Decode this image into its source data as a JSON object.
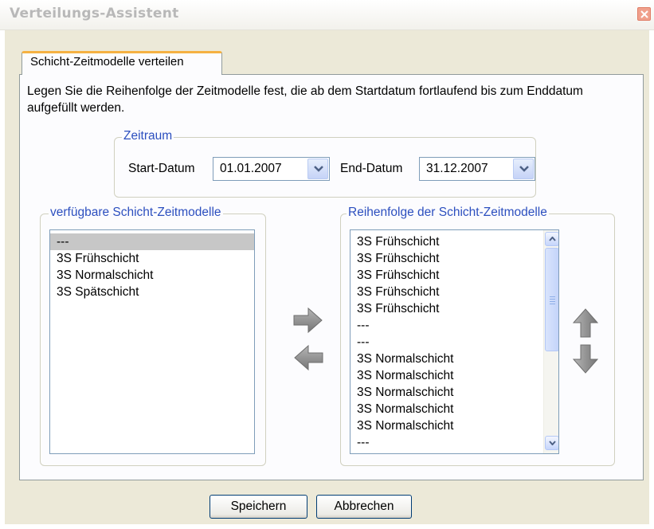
{
  "window": {
    "title": "Verteilungs-Assistent",
    "close_icon": "close-icon"
  },
  "tab": {
    "label": "Schicht-Zeitmodelle verteilen"
  },
  "instruction": "Legen Sie die Reihenfolge der Zeitmodelle fest, die ab dem Startdatum fortlaufend bis zum Enddatum aufgefüllt werden.",
  "zeitraum": {
    "legend": "Zeitraum",
    "start_label": "Start-Datum",
    "start_value": "01.01.2007",
    "end_label": "End-Datum",
    "end_value": "31.12.2007"
  },
  "available": {
    "legend": "verfügbare Schicht-Zeitmodelle",
    "items": [
      "---",
      "3S Frühschicht",
      "3S Normalschicht",
      "3S Spätschicht"
    ],
    "selected_index": 0
  },
  "order": {
    "legend": "Reihenfolge der Schicht-Zeitmodelle",
    "items": [
      "3S Frühschicht",
      "3S Frühschicht",
      "3S Frühschicht",
      "3S Frühschicht",
      "3S Frühschicht",
      "---",
      "---",
      "3S Normalschicht",
      "3S Normalschicht",
      "3S Normalschicht",
      "3S Normalschicht",
      "3S Normalschicht",
      "---"
    ]
  },
  "icons": {
    "add": "arrow-right-icon",
    "remove": "arrow-left-icon",
    "move_up": "arrow-up-icon",
    "move_down": "arrow-down-icon"
  },
  "buttons": {
    "save": "Speichern",
    "cancel": "Abbrechen"
  },
  "colors": {
    "legend": "#2c4fbf",
    "tab_accent": "#f5b142",
    "arrow": "#8d8d8d",
    "selection": "#c7c7c7"
  }
}
